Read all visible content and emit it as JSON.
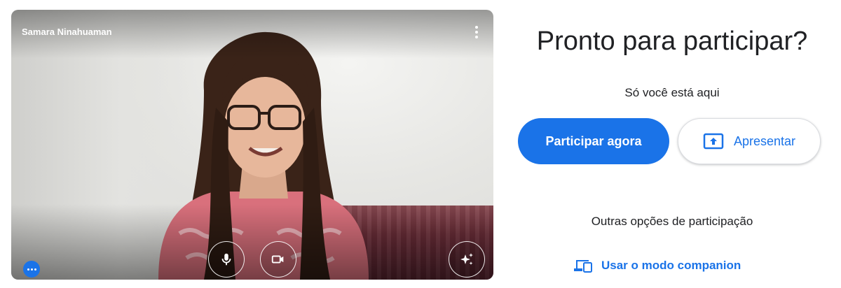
{
  "preview": {
    "participant_name": "Samara Ninahuaman",
    "icons": {
      "more_options": "more-vert-icon",
      "microphone": "mic-icon",
      "camera": "videocam-icon",
      "visual_effects": "sparkle-icon",
      "more_actions": "more-horiz-icon"
    }
  },
  "panel": {
    "title": "Pronto para participar?",
    "status": "Só você está aqui",
    "join_label": "Participar agora",
    "present_label": "Apresentar",
    "other_options_label": "Outras opções de participação",
    "companion_label": "Usar o modo companion"
  },
  "colors": {
    "accent": "#1a73e8",
    "text_primary": "#202124",
    "border": "#dadce0"
  }
}
